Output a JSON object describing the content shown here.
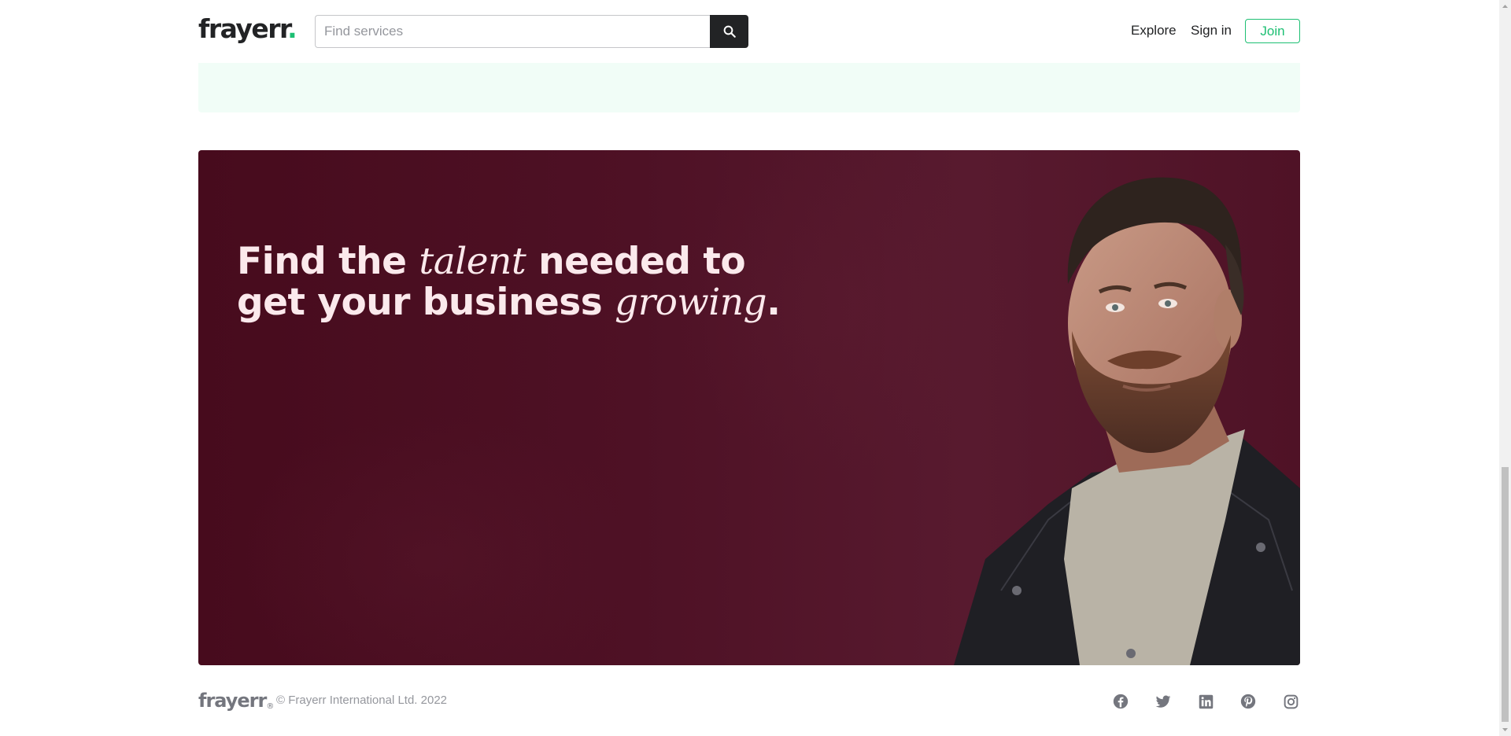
{
  "header": {
    "logo_text": "frayerr",
    "logo_dot": ".",
    "search_placeholder": "Find services",
    "nav_explore": "Explore",
    "nav_signin": "Sign in",
    "join_label": "Join"
  },
  "banner": {
    "line1_a": "Find the ",
    "line1_em": "talent",
    "line1_b": " needed to",
    "line2_a": "get your business ",
    "line2_em": "growing",
    "line2_b": "."
  },
  "footer": {
    "logo_text": "frayerr",
    "logo_mark": "®",
    "copyright": "© Frayerr International Ltd. 2022",
    "social": [
      "facebook-icon",
      "twitter-icon",
      "linkedin-icon",
      "pinterest-icon",
      "instagram-icon"
    ]
  },
  "colors": {
    "brand_green": "#1dbf73",
    "banner_bg": "#4e1125",
    "mint": "#f1fdf7",
    "text_dark": "#222325",
    "text_muted": "#74767e"
  }
}
